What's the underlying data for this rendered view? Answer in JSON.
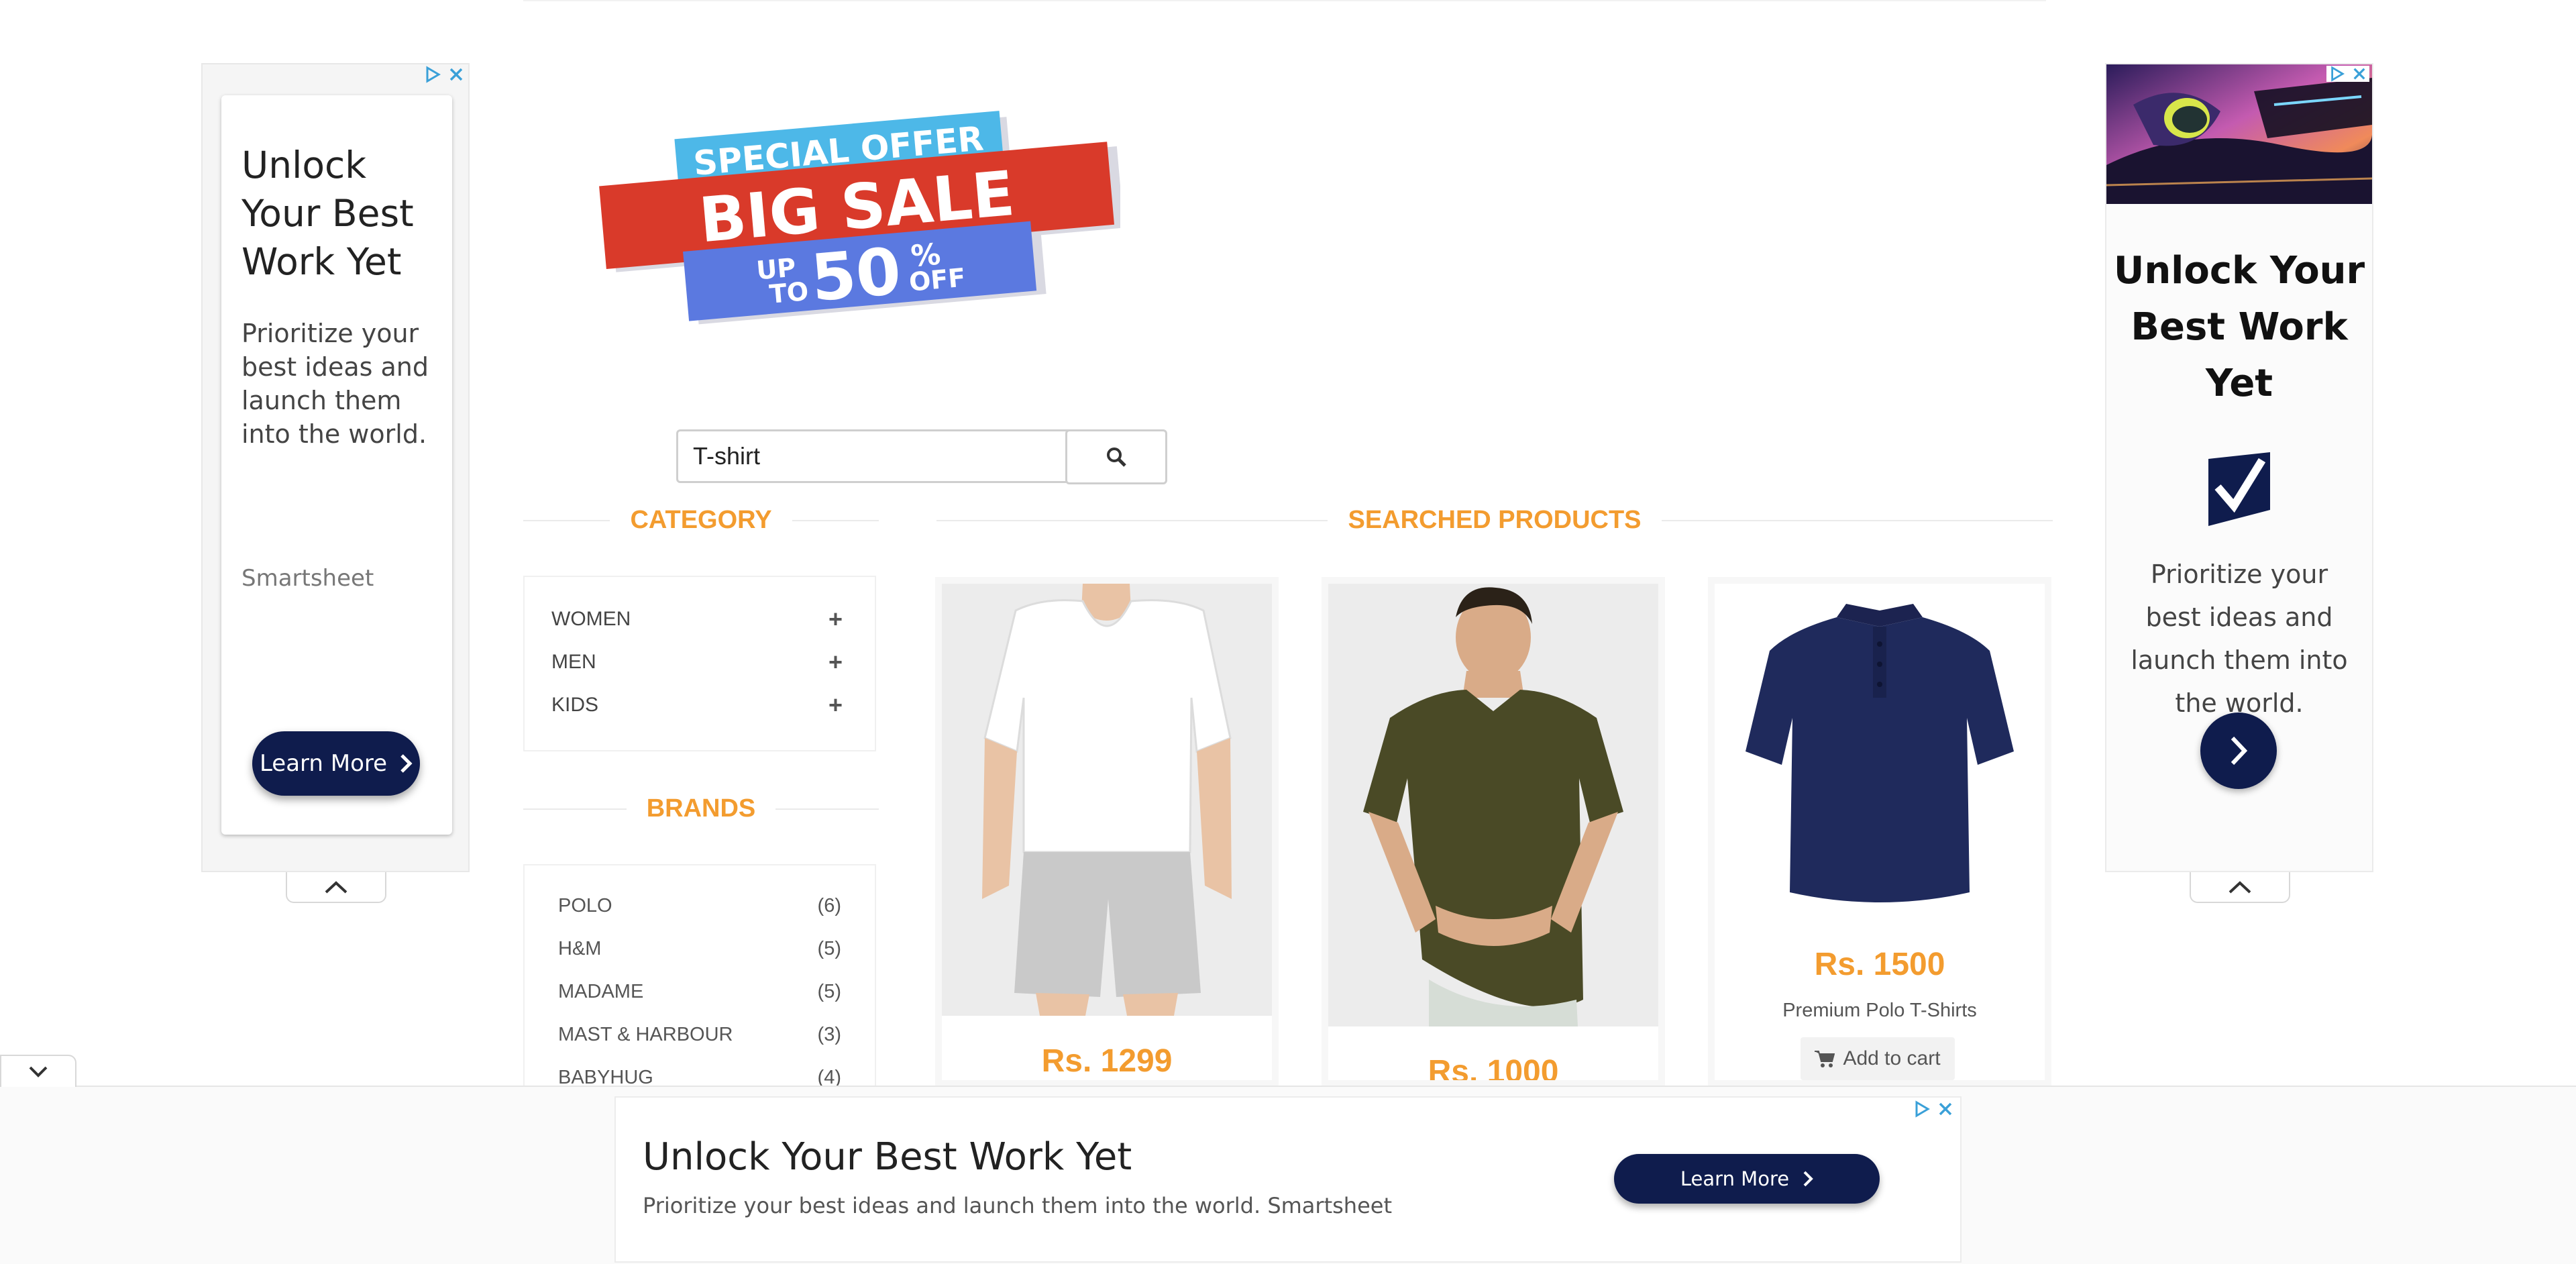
{
  "ads": {
    "left": {
      "headline": "Unlock Your Best Work Yet",
      "body": "Prioritize your best ideas and launch them into the world.",
      "brand": "Smartsheet",
      "cta": "Learn More"
    },
    "right": {
      "headline": "Unlock Your Best Work Yet",
      "body": "Prioritize your best ideas and launch them into the world."
    },
    "bottom": {
      "headline": "Unlock Your Best Work Yet",
      "body": "Prioritize your best ideas and launch them into the world. Smartsheet",
      "cta": "Learn More"
    }
  },
  "banner": {
    "top_text": "SPECIAL OFFER",
    "main_text": "BIG SALE",
    "up_to": "UP",
    "to": "TO",
    "percent": "50",
    "percent_sign": "%",
    "off": "OFF"
  },
  "search": {
    "value": "T-shirt"
  },
  "sidebar": {
    "category_heading": "CATEGORY",
    "categories": [
      {
        "label": "WOMEN"
      },
      {
        "label": "MEN"
      },
      {
        "label": "KIDS"
      }
    ],
    "brands_heading": "BRANDS",
    "brands": [
      {
        "label": "POLO",
        "count": "(6)"
      },
      {
        "label": "H&M",
        "count": "(5)"
      },
      {
        "label": "MADAME",
        "count": "(5)"
      },
      {
        "label": "MAST & HARBOUR",
        "count": "(3)"
      },
      {
        "label": "BABYHUG",
        "count": "(4)"
      }
    ]
  },
  "products": {
    "heading": "SEARCHED PRODUCTS",
    "items": [
      {
        "price": "Rs. 1299"
      },
      {
        "price": "Rs. 1000"
      },
      {
        "price": "Rs. 1500",
        "name": "Premium Polo T-Shirts",
        "cart_label": "Add to cart"
      }
    ]
  },
  "colors": {
    "accent": "#f39c2f",
    "ad_navy": "#0f1c4d"
  }
}
